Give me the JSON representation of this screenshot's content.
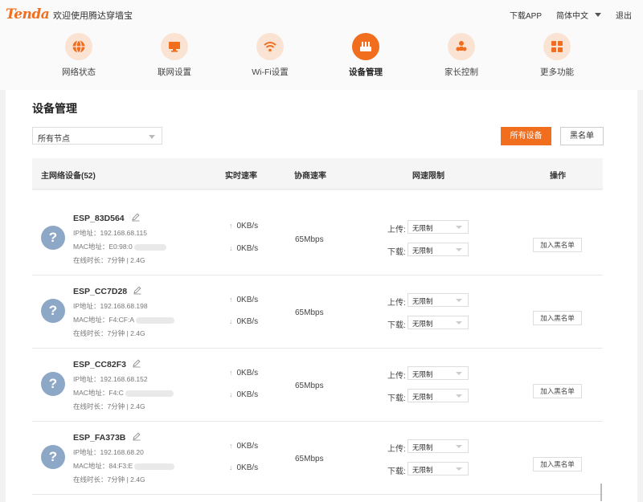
{
  "brand": {
    "logo": "Tenda",
    "welcome": "欢迎使用腾达穿墙宝",
    "accent": "#f06e1e"
  },
  "topbar": {
    "download_app": "下载APP",
    "language": "简体中文",
    "logout": "退出"
  },
  "nav": {
    "items": [
      {
        "label": "网络状态",
        "icon": "globe-icon"
      },
      {
        "label": "联网设置",
        "icon": "monitor-icon"
      },
      {
        "label": "Wi-Fi设置",
        "icon": "wifi-icon"
      },
      {
        "label": "设备管理",
        "icon": "router-icon",
        "active": true
      },
      {
        "label": "家长控制",
        "icon": "parental-icon"
      },
      {
        "label": "更多功能",
        "icon": "grid-icon"
      }
    ]
  },
  "page": {
    "title": "设备管理",
    "node_select": "所有节点",
    "btn_all_devices": "所有设备",
    "btn_blacklist": "黑名单"
  },
  "table": {
    "headers": {
      "device": "主网络设备(52)",
      "realtime": "实时速率",
      "negotiated": "协商速率",
      "limit": "网速限制",
      "action": "操作"
    }
  },
  "devices": [
    {
      "name": "ESP_83D564",
      "ip": "IP地址：192.168.68.115",
      "mac": "MAC地址：E0:98:0",
      "online": "在线时长：7分钟 | 2.4G",
      "up": "0KB/s",
      "down": "0KB/s",
      "nego": "65Mbps",
      "up_label": "上传:",
      "down_label": "下载:",
      "up_limit": "无限制",
      "down_limit": "无限制",
      "action": "加入黑名单"
    },
    {
      "name": "ESP_CC7D28",
      "ip": "IP地址：192.168.68.198",
      "mac": "MAC地址：F4:CF:A",
      "online": "在线时长：7分钟 | 2.4G",
      "up": "0KB/s",
      "down": "0KB/s",
      "nego": "65Mbps",
      "up_label": "上传:",
      "down_label": "下载:",
      "up_limit": "无限制",
      "down_limit": "无限制",
      "action": "加入黑名单"
    },
    {
      "name": "ESP_CC82F3",
      "ip": "IP地址：192.168.68.152",
      "mac": "MAC地址：F4:C",
      "online": "在线时长：7分钟 | 2.4G",
      "up": "0KB/s",
      "down": "0KB/s",
      "nego": "65Mbps",
      "up_label": "上传:",
      "down_label": "下载:",
      "up_limit": "无限制",
      "down_limit": "无限制",
      "action": "加入黑名单"
    },
    {
      "name": "ESP_FA373B",
      "ip": "IP地址：192.168.68.20",
      "mac": "MAC地址：84:F3:E",
      "online": "在线时长：7分钟 | 2.4G",
      "up": "0KB/s",
      "down": "0KB/s",
      "nego": "65Mbps",
      "up_label": "上传:",
      "down_label": "下载:",
      "up_limit": "无限制",
      "down_limit": "无限制",
      "action": "加入黑名单"
    }
  ]
}
